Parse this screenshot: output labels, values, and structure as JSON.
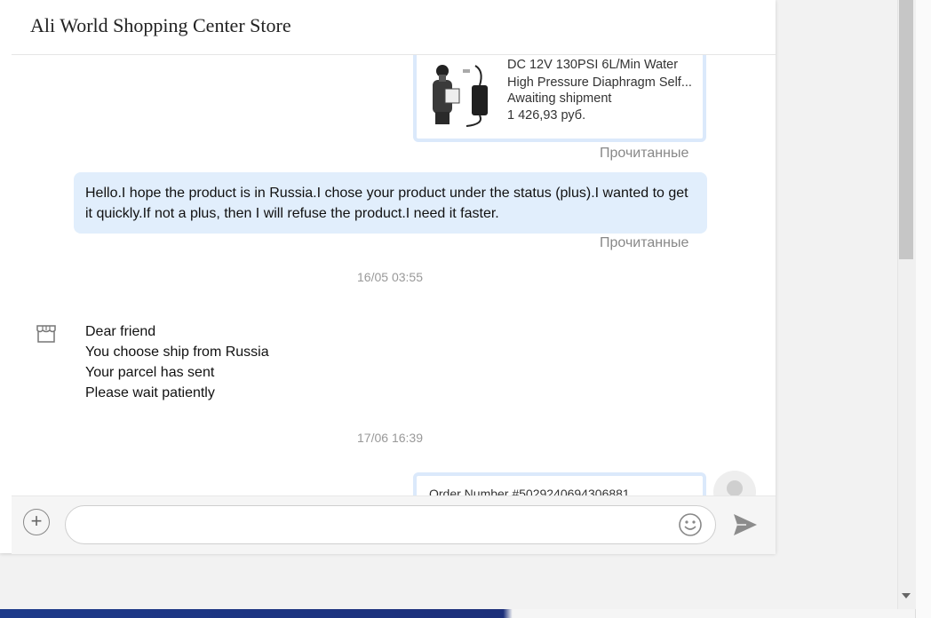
{
  "header": {
    "title": "Ali World Shopping Center Store"
  },
  "messages": {
    "product_card": {
      "name": "DC 12V 130PSI 6L/Min Water High Pressure Diaphragm Self...",
      "status": "Awaiting shipment",
      "price": "1 426,93 руб.",
      "image_icon": "water-pump-image"
    },
    "read_label_1": "Прочитанные",
    "outgoing_text": "Hello.I hope the product is in Russia.I chose your product under the status (plus).I wanted to get it quickly.If not a plus, then I will refuse the product.I need it faster.",
    "read_label_2": "Прочитанные",
    "timestamp_1": "16/05 03:55",
    "incoming_lines": [
      "Dear friend",
      "You choose ship from Russia",
      "Your parcel has sent",
      "Please wait patiently"
    ],
    "timestamp_2": "17/06 16:39",
    "order_card": {
      "order_number": "Order Number #5029240694306881"
    }
  },
  "input_bar": {
    "plus_label": "+",
    "placeholder": "",
    "emoji_icon": "smiley-icon",
    "send_icon": "send-icon"
  },
  "colors": {
    "bubble_out": "#e1eefc",
    "card_border": "#dbe9fb",
    "read_label": "#888888"
  }
}
